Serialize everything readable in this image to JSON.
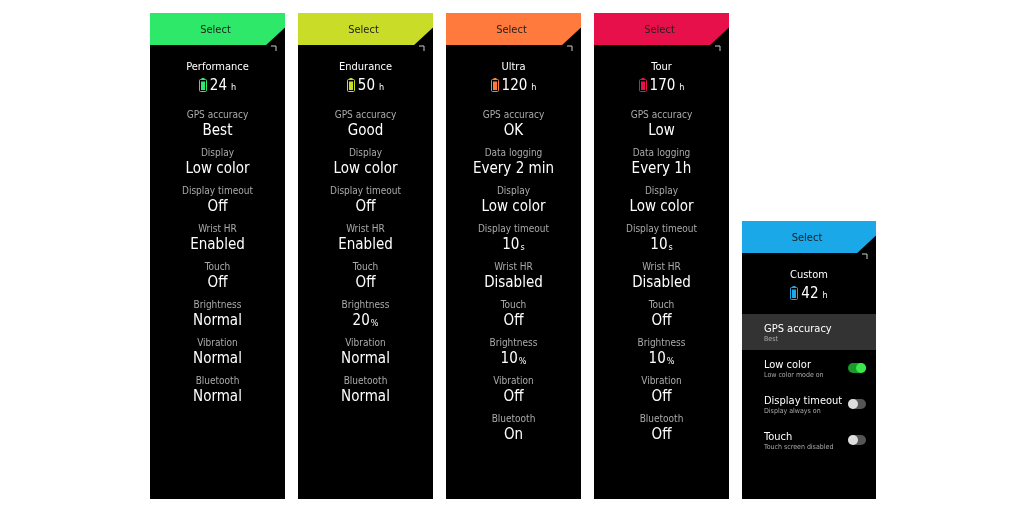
{
  "modes": [
    {
      "header": "Select",
      "color": "#2ee86a",
      "name": "Performance",
      "hours": "24",
      "hours_unit": "h",
      "settings": [
        {
          "label": "GPS accuracy",
          "value": "Best"
        },
        {
          "label": "Display",
          "value": "Low color"
        },
        {
          "label": "Display timeout",
          "value": "Off"
        },
        {
          "label": "Wrist HR",
          "value": "Enabled"
        },
        {
          "label": "Touch",
          "value": "Off"
        },
        {
          "label": "Brightness",
          "value": "Normal"
        },
        {
          "label": "Vibration",
          "value": "Normal"
        },
        {
          "label": "Bluetooth",
          "value": "Normal"
        }
      ]
    },
    {
      "header": "Select",
      "color": "#c8dc28",
      "name": "Endurance",
      "hours": "50",
      "hours_unit": "h",
      "settings": [
        {
          "label": "GPS accuracy",
          "value": "Good"
        },
        {
          "label": "Display",
          "value": "Low color"
        },
        {
          "label": "Display timeout",
          "value": "Off"
        },
        {
          "label": "Wrist HR",
          "value": "Enabled"
        },
        {
          "label": "Touch",
          "value": "Off"
        },
        {
          "label": "Brightness",
          "value": "20",
          "unit": "%"
        },
        {
          "label": "Vibration",
          "value": "Normal"
        },
        {
          "label": "Bluetooth",
          "value": "Normal"
        }
      ]
    },
    {
      "header": "Select",
      "color": "#ff7a3c",
      "name": "Ultra",
      "hours": "120",
      "hours_unit": "h",
      "settings": [
        {
          "label": "GPS accuracy",
          "value": "OK"
        },
        {
          "label": "Data logging",
          "value": "Every 2 min"
        },
        {
          "label": "Display",
          "value": "Low color"
        },
        {
          "label": "Display timeout",
          "value": "10",
          "unit": "s"
        },
        {
          "label": "Wrist HR",
          "value": "Disabled"
        },
        {
          "label": "Touch",
          "value": "Off"
        },
        {
          "label": "Brightness",
          "value": "10",
          "unit": "%"
        },
        {
          "label": "Vibration",
          "value": "Off"
        },
        {
          "label": "Bluetooth",
          "value": "On"
        }
      ]
    },
    {
      "header": "Select",
      "color": "#e8104a",
      "name": "Tour",
      "hours": "170",
      "hours_unit": "h",
      "settings": [
        {
          "label": "GPS accuracy",
          "value": "Low"
        },
        {
          "label": "Data logging",
          "value": "Every 1h"
        },
        {
          "label": "Display",
          "value": "Low color"
        },
        {
          "label": "Display timeout",
          "value": "10",
          "unit": "s"
        },
        {
          "label": "Wrist HR",
          "value": "Disabled"
        },
        {
          "label": "Touch",
          "value": "Off"
        },
        {
          "label": "Brightness",
          "value": "10",
          "unit": "%"
        },
        {
          "label": "Vibration",
          "value": "Off"
        },
        {
          "label": "Bluetooth",
          "value": "Off"
        }
      ]
    }
  ],
  "custom": {
    "header": "Select",
    "color": "#1aa8e8",
    "name": "Custom",
    "hours": "42",
    "hours_unit": "h",
    "items": [
      {
        "kind": "option",
        "label": "GPS accuracy",
        "detail": "Best",
        "selected": true
      },
      {
        "kind": "toggle",
        "label": "Low color",
        "detail": "Low color mode on",
        "on": true,
        "selected": false
      },
      {
        "kind": "toggle",
        "label": "Display timeout",
        "detail": "Display always on",
        "on": false,
        "selected": false
      },
      {
        "kind": "toggle",
        "label": "Touch",
        "detail": "Touch screen disabled",
        "on": false,
        "selected": false
      }
    ]
  }
}
